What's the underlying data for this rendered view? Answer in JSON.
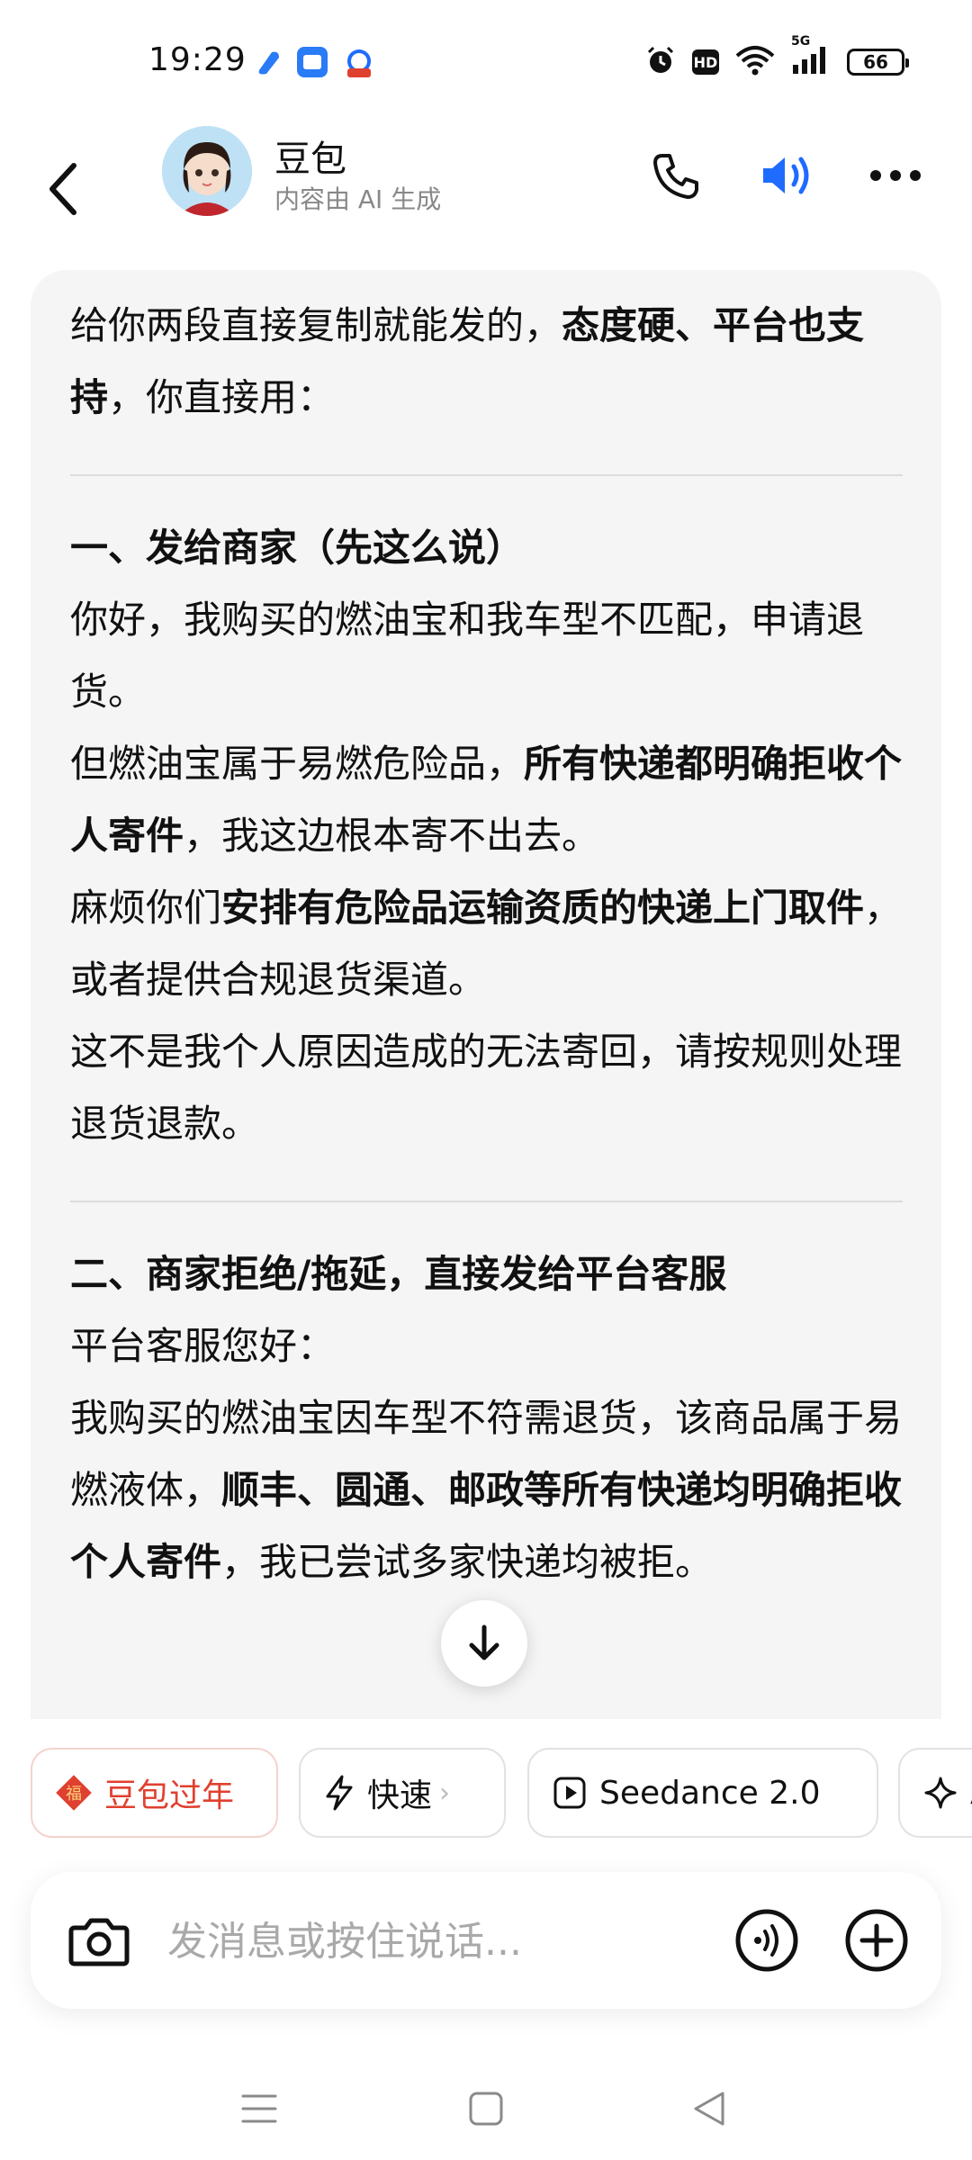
{
  "status_bar": {
    "time": "19:29",
    "battery": "66",
    "hd": "HD",
    "network": "5G"
  },
  "header": {
    "title": "豆包",
    "subtitle": "内容由 AI 生成"
  },
  "message": {
    "intro_plain_1": "给你两段直接复制就能发的，",
    "intro_bold": "态度硬、平台也支持",
    "intro_plain_2": "，你直接用：",
    "section1_title": "一、发给商家（先这么说）",
    "s1_line1": "你好，我购买的燃油宝和我车型不匹配，申请退货。",
    "s1_line2_plain": "但燃油宝属于易燃危险品，",
    "s1_line2_bold": "所有快递都明确拒收个人寄件",
    "s1_line2_end": "，我这边根本寄不出去。",
    "s1_line3_plain": "麻烦你们",
    "s1_line3_bold": "安排有危险品运输资质的快递上门取件",
    "s1_line3_end": "，或者提供合规退货渠道。",
    "s1_line4": "这不是我个人原因造成的无法寄回，请按规则处理退货退款。",
    "section2_title": "二、商家拒绝/拖延，直接发给平台客服",
    "s2_line1": "平台客服您好：",
    "s2_line2_plain": "我购买的燃油宝因车型不符需退货，该商品属于易燃液体，",
    "s2_line2_bold": "顺丰、圆通、邮政等所有快递均明确拒收个人寄件",
    "s2_line2_end": "，我已尝试多家快递均被拒。"
  },
  "chips": [
    {
      "label": "豆包过年",
      "icon": "fu-icon"
    },
    {
      "label": "快速",
      "icon": "lightning-icon"
    },
    {
      "label": "Seedance 2.0",
      "icon": "play-icon"
    },
    {
      "label": "A",
      "icon": "sparkle-icon"
    }
  ],
  "input": {
    "placeholder": "发消息或按住说话..."
  },
  "colors": {
    "accent_blue": "#1f6bff",
    "festival_red": "#e0402f",
    "card_bg": "#f5f5f6"
  }
}
